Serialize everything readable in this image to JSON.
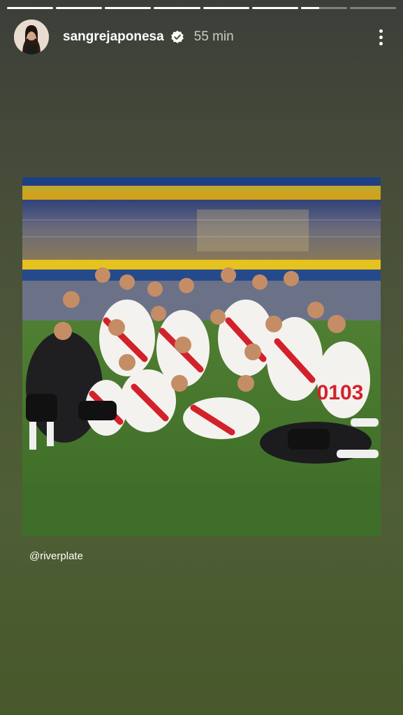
{
  "story": {
    "progress": [
      1,
      1,
      1,
      1,
      1,
      1,
      0.4,
      0
    ],
    "username": "sangrejaponesa",
    "verified": true,
    "time": "55 min"
  },
  "post": {
    "mention": "@riverplate",
    "jersey_number": "0103"
  },
  "icons": {
    "verified": "verified-badge-icon",
    "more": "more-vertical-icon"
  },
  "colors": {
    "river_red": "#d3212b",
    "boca_blue": "#1a3f8c",
    "boca_yellow": "#f2c200"
  }
}
